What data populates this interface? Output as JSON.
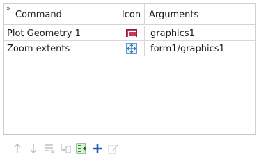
{
  "table": {
    "columns": {
      "command": "Command",
      "icon": "Icon",
      "arguments": "Arguments"
    },
    "rows": [
      {
        "command": "Plot Geometry 1",
        "icon": "plot-geometry-icon",
        "arguments": "graphics1"
      },
      {
        "command": "Zoom extents",
        "icon": "zoom-extents-icon",
        "arguments": "form1/graphics1"
      }
    ]
  },
  "toolbar": {
    "buttons": [
      {
        "name": "move-up-button",
        "icon": "arrow-up-icon",
        "enabled": false
      },
      {
        "name": "move-down-button",
        "icon": "arrow-down-icon",
        "enabled": false
      },
      {
        "name": "delete-button",
        "icon": "delete-list-icon",
        "enabled": false
      },
      {
        "name": "insert-button",
        "icon": "insert-icon",
        "enabled": false
      },
      {
        "name": "add-command-button",
        "icon": "add-command-icon",
        "enabled": true
      },
      {
        "name": "add-button",
        "icon": "plus-icon",
        "enabled": true
      },
      {
        "name": "edit-button",
        "icon": "edit-icon",
        "enabled": false
      }
    ]
  },
  "colors": {
    "plot_icon": "#c8365a",
    "zoom_icon": "#5b9bd5",
    "add_icon": "#1f5fb4",
    "add_command_icon": "#2e8b3a",
    "disabled": "#b9c0c8"
  }
}
